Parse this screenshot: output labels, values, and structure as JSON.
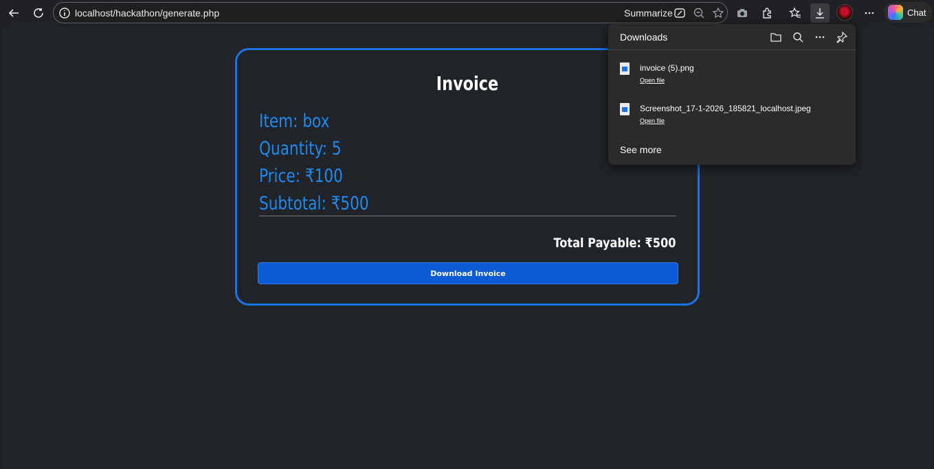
{
  "browser": {
    "url": "localhost/hackathon/generate.php",
    "summarize_label": "Summarize",
    "chat_label": "Chat"
  },
  "invoice": {
    "title": "Invoice",
    "lines": [
      "Item: box",
      "Quantity: 5",
      "Price: ₹100",
      "Subtotal: ₹500"
    ],
    "total": "Total Payable: ₹500",
    "download_label": "Download Invoice"
  },
  "downloads": {
    "title": "Downloads",
    "items": [
      {
        "name": "invoice (5).png",
        "action": "Open file"
      },
      {
        "name": "Screenshot_17-1-2026_185821_localhost.jpeg",
        "action": "Open file"
      }
    ],
    "see_more": "See more"
  },
  "colors": {
    "accent": "#1a73e8",
    "invoice_text": "#1e8aef",
    "button": "#0b5bd7",
    "page_bg": "#202328"
  }
}
